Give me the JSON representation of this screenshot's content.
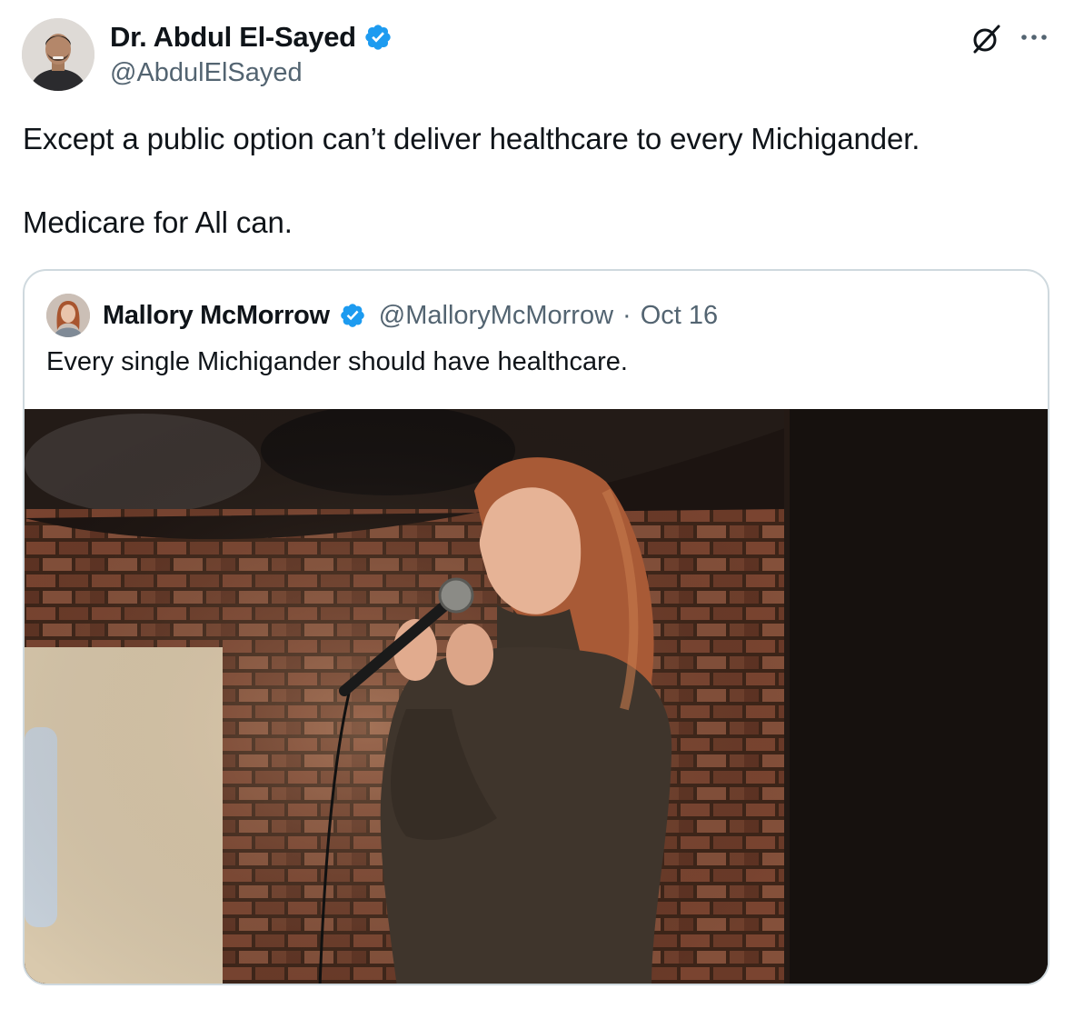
{
  "author": {
    "display_name": "Dr. Abdul El-Sayed",
    "handle": "@AbdulElSayed",
    "verified": true
  },
  "tweet": {
    "paragraphs": [
      "Except a public option can’t deliver healthcare to every Michigander.",
      "Medicare for All can."
    ]
  },
  "quote": {
    "display_name": "Mallory McMorrow",
    "handle": "@MalloryMcMorrow",
    "separator": "·",
    "date": "Oct 16",
    "text": "Every single Michigander should have healthcare.",
    "verified": true
  },
  "icons": {
    "grok": "grok-icon",
    "more": "more-icon",
    "verified": "verified-badge-icon"
  },
  "colors": {
    "text": "#0f1419",
    "secondary": "#536471",
    "verified": "#1d9bf0",
    "border": "#cfd9de"
  }
}
